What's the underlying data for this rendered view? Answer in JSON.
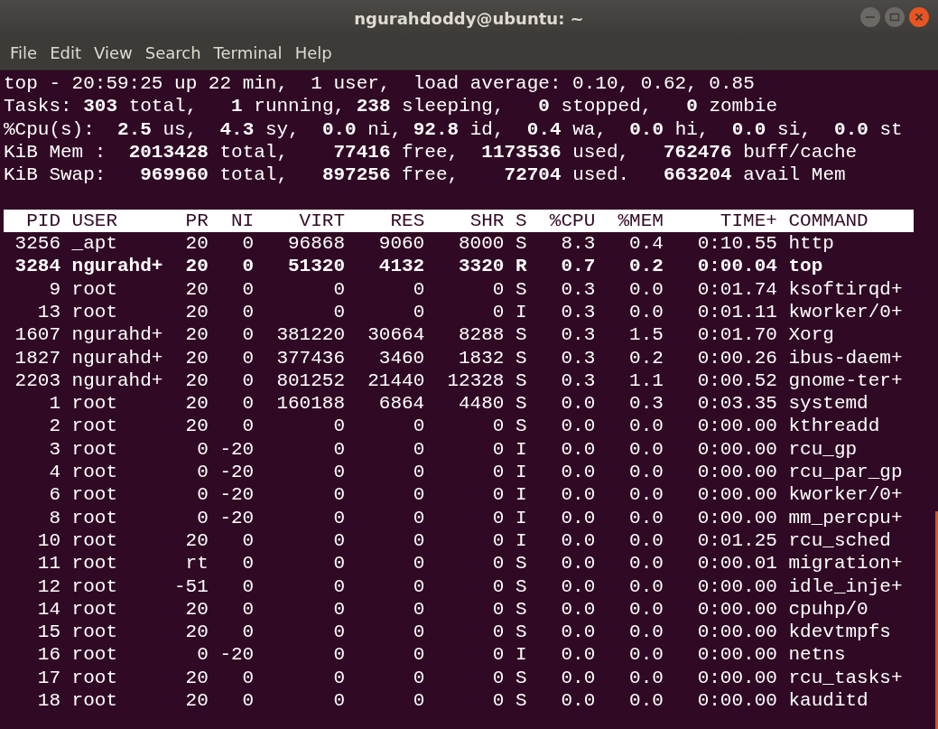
{
  "window": {
    "title": "ngurahdoddy@ubuntu: ~"
  },
  "menu": [
    "File",
    "Edit",
    "View",
    "Search",
    "Terminal",
    "Help"
  ],
  "summary": [
    "top - 20:59:25 up 22 min,  1 user,  load average: 0.10, 0.62, 0.85",
    "Tasks: **303** total,   **1** running, **238** sleeping,   **0** stopped,   **0** zombie",
    "%Cpu(s):  **2.5** us,  **4.3** sy,  **0.0** ni, **92.8** id,  **0.4** wa,  **0.0** hi,  **0.0** si,  **0.0** st",
    "KiB Mem :  **2013428** total,    **77416** free,  **1173536** used,   **762476** buff/cache",
    "KiB Swap:   **969960** total,   **897256** free,    **72704** used.   **663204** avail Mem"
  ],
  "table": {
    "columns": [
      "PID",
      "USER",
      "PR",
      "NI",
      "VIRT",
      "RES",
      "SHR",
      "S",
      "%CPU",
      "%MEM",
      "TIME+",
      "COMMAND"
    ],
    "rows": [
      {
        "highlighted": false,
        "cells": [
          "3256",
          "_apt",
          "20",
          "0",
          "96868",
          "9060",
          "8000",
          "S",
          "8.3",
          "0.4",
          "0:10.55",
          "http"
        ]
      },
      {
        "highlighted": true,
        "cells": [
          "3284",
          "ngurahd+",
          "20",
          "0",
          "51320",
          "4132",
          "3320",
          "R",
          "0.7",
          "0.2",
          "0:00.04",
          "top"
        ]
      },
      {
        "highlighted": false,
        "cells": [
          "9",
          "root",
          "20",
          "0",
          "0",
          "0",
          "0",
          "S",
          "0.3",
          "0.0",
          "0:01.74",
          "ksoftirqd+"
        ]
      },
      {
        "highlighted": false,
        "cells": [
          "13",
          "root",
          "20",
          "0",
          "0",
          "0",
          "0",
          "I",
          "0.3",
          "0.0",
          "0:01.11",
          "kworker/0+"
        ]
      },
      {
        "highlighted": false,
        "cells": [
          "1607",
          "ngurahd+",
          "20",
          "0",
          "381220",
          "30664",
          "8288",
          "S",
          "0.3",
          "1.5",
          "0:01.70",
          "Xorg"
        ]
      },
      {
        "highlighted": false,
        "cells": [
          "1827",
          "ngurahd+",
          "20",
          "0",
          "377436",
          "3460",
          "1832",
          "S",
          "0.3",
          "0.2",
          "0:00.26",
          "ibus-daem+"
        ]
      },
      {
        "highlighted": false,
        "cells": [
          "2203",
          "ngurahd+",
          "20",
          "0",
          "801252",
          "21440",
          "12328",
          "S",
          "0.3",
          "1.1",
          "0:00.52",
          "gnome-ter+"
        ]
      },
      {
        "highlighted": false,
        "cells": [
          "1",
          "root",
          "20",
          "0",
          "160188",
          "6864",
          "4480",
          "S",
          "0.0",
          "0.3",
          "0:03.35",
          "systemd"
        ]
      },
      {
        "highlighted": false,
        "cells": [
          "2",
          "root",
          "20",
          "0",
          "0",
          "0",
          "0",
          "S",
          "0.0",
          "0.0",
          "0:00.00",
          "kthreadd"
        ]
      },
      {
        "highlighted": false,
        "cells": [
          "3",
          "root",
          "0",
          "-20",
          "0",
          "0",
          "0",
          "I",
          "0.0",
          "0.0",
          "0:00.00",
          "rcu_gp"
        ]
      },
      {
        "highlighted": false,
        "cells": [
          "4",
          "root",
          "0",
          "-20",
          "0",
          "0",
          "0",
          "I",
          "0.0",
          "0.0",
          "0:00.00",
          "rcu_par_gp"
        ]
      },
      {
        "highlighted": false,
        "cells": [
          "6",
          "root",
          "0",
          "-20",
          "0",
          "0",
          "0",
          "I",
          "0.0",
          "0.0",
          "0:00.00",
          "kworker/0+"
        ]
      },
      {
        "highlighted": false,
        "cells": [
          "8",
          "root",
          "0",
          "-20",
          "0",
          "0",
          "0",
          "I",
          "0.0",
          "0.0",
          "0:00.00",
          "mm_percpu+"
        ]
      },
      {
        "highlighted": false,
        "cells": [
          "10",
          "root",
          "20",
          "0",
          "0",
          "0",
          "0",
          "I",
          "0.0",
          "0.0",
          "0:01.25",
          "rcu_sched"
        ]
      },
      {
        "highlighted": false,
        "cells": [
          "11",
          "root",
          "rt",
          "0",
          "0",
          "0",
          "0",
          "S",
          "0.0",
          "0.0",
          "0:00.01",
          "migration+"
        ]
      },
      {
        "highlighted": false,
        "cells": [
          "12",
          "root",
          "-51",
          "0",
          "0",
          "0",
          "0",
          "S",
          "0.0",
          "0.0",
          "0:00.00",
          "idle_inje+"
        ]
      },
      {
        "highlighted": false,
        "cells": [
          "14",
          "root",
          "20",
          "0",
          "0",
          "0",
          "0",
          "S",
          "0.0",
          "0.0",
          "0:00.00",
          "cpuhp/0"
        ]
      },
      {
        "highlighted": false,
        "cells": [
          "15",
          "root",
          "20",
          "0",
          "0",
          "0",
          "0",
          "S",
          "0.0",
          "0.0",
          "0:00.00",
          "kdevtmpfs"
        ]
      },
      {
        "highlighted": false,
        "cells": [
          "16",
          "root",
          "0",
          "-20",
          "0",
          "0",
          "0",
          "I",
          "0.0",
          "0.0",
          "0:00.00",
          "netns"
        ]
      },
      {
        "highlighted": false,
        "cells": [
          "17",
          "root",
          "20",
          "0",
          "0",
          "0",
          "0",
          "S",
          "0.0",
          "0.0",
          "0:00.00",
          "rcu_tasks+"
        ]
      },
      {
        "highlighted": false,
        "cells": [
          "18",
          "root",
          "20",
          "0",
          "0",
          "0",
          "0",
          "S",
          "0.0",
          "0.0",
          "0:00.00",
          "kauditd"
        ]
      }
    ]
  }
}
